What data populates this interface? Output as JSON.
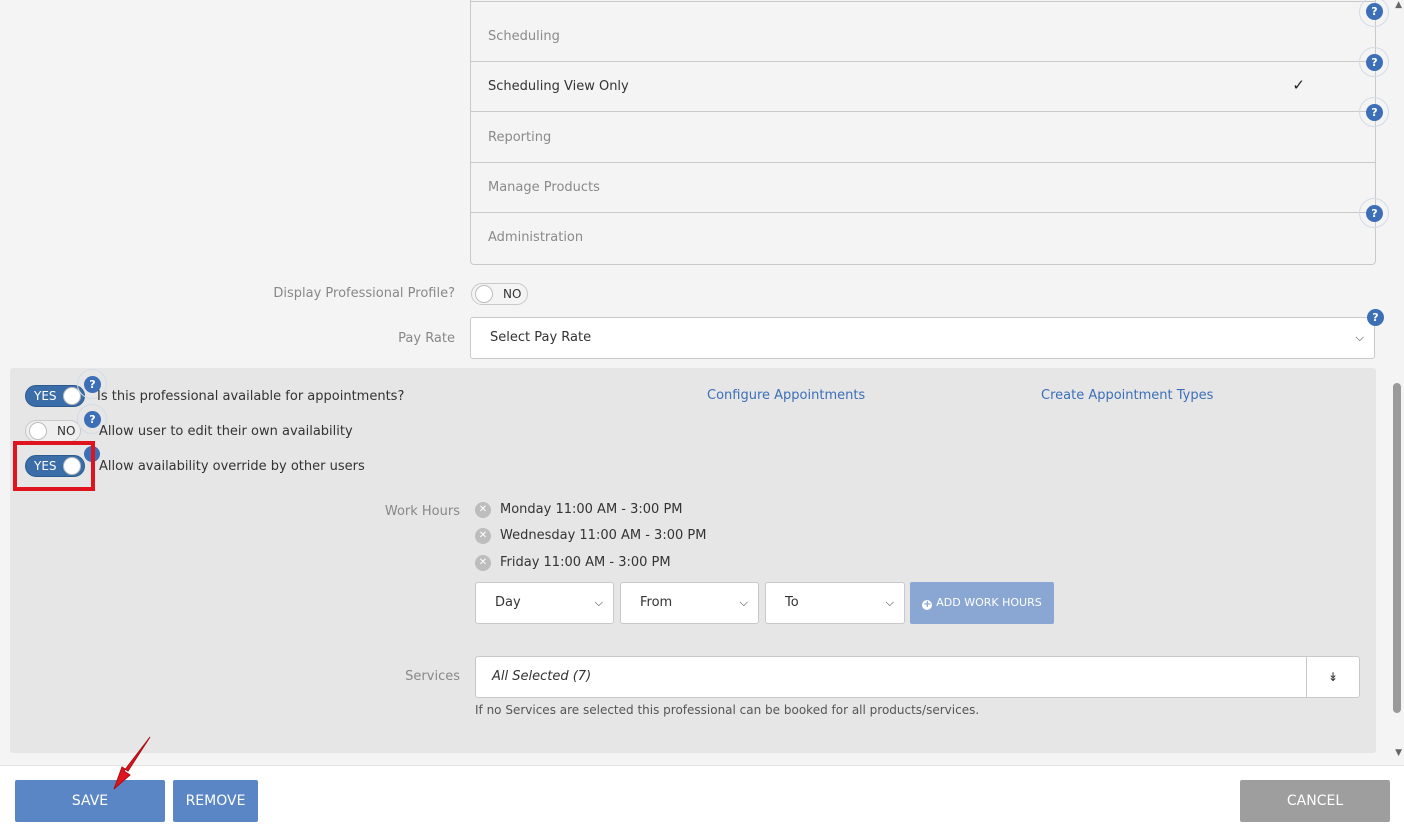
{
  "permissions": {
    "items": [
      {
        "label": "Scheduling",
        "checked": false
      },
      {
        "label": "Scheduling View Only",
        "checked": true
      },
      {
        "label": "Reporting",
        "checked": false
      },
      {
        "label": "Manage Products",
        "checked": false
      },
      {
        "label": "Administration",
        "checked": false
      }
    ],
    "check_mark": "✓"
  },
  "help_glyph": "?",
  "display_profile": {
    "label": "Display Professional Profile?",
    "toggle": "NO"
  },
  "pay_rate": {
    "label": "Pay Rate",
    "selected": "Select Pay Rate"
  },
  "availability": {
    "available_toggle": "YES",
    "available_label": "Is this professional available for appointments?",
    "edit_own_toggle": "NO",
    "edit_own_label": "Allow user to edit their own availability",
    "override_toggle": "YES",
    "override_label": "Allow availability override by other users",
    "configure_link": "Configure Appointments",
    "create_types_link": "Create Appointment Types"
  },
  "work_hours": {
    "label": "Work Hours",
    "entries": [
      "Monday 11:00 AM - 3:00 PM",
      "Wednesday 11:00 AM - 3:00 PM",
      "Friday 11:00 AM - 3:00 PM"
    ],
    "day_select": "Day",
    "from_select": "From",
    "to_select": "To",
    "add_button": "ADD WORK HOURS"
  },
  "services": {
    "label": "Services",
    "value": "All Selected (7)",
    "hint": "If no Services are selected this professional can be booked for all products/services."
  },
  "footer": {
    "save": "SAVE",
    "remove": "REMOVE",
    "cancel": "CANCEL"
  },
  "colors": {
    "accent": "#3b6ea9",
    "button": "#5b86c5",
    "cancel": "#9e9e9e",
    "highlight": "#e0141e",
    "annotation_arrow": "#e0141e"
  }
}
